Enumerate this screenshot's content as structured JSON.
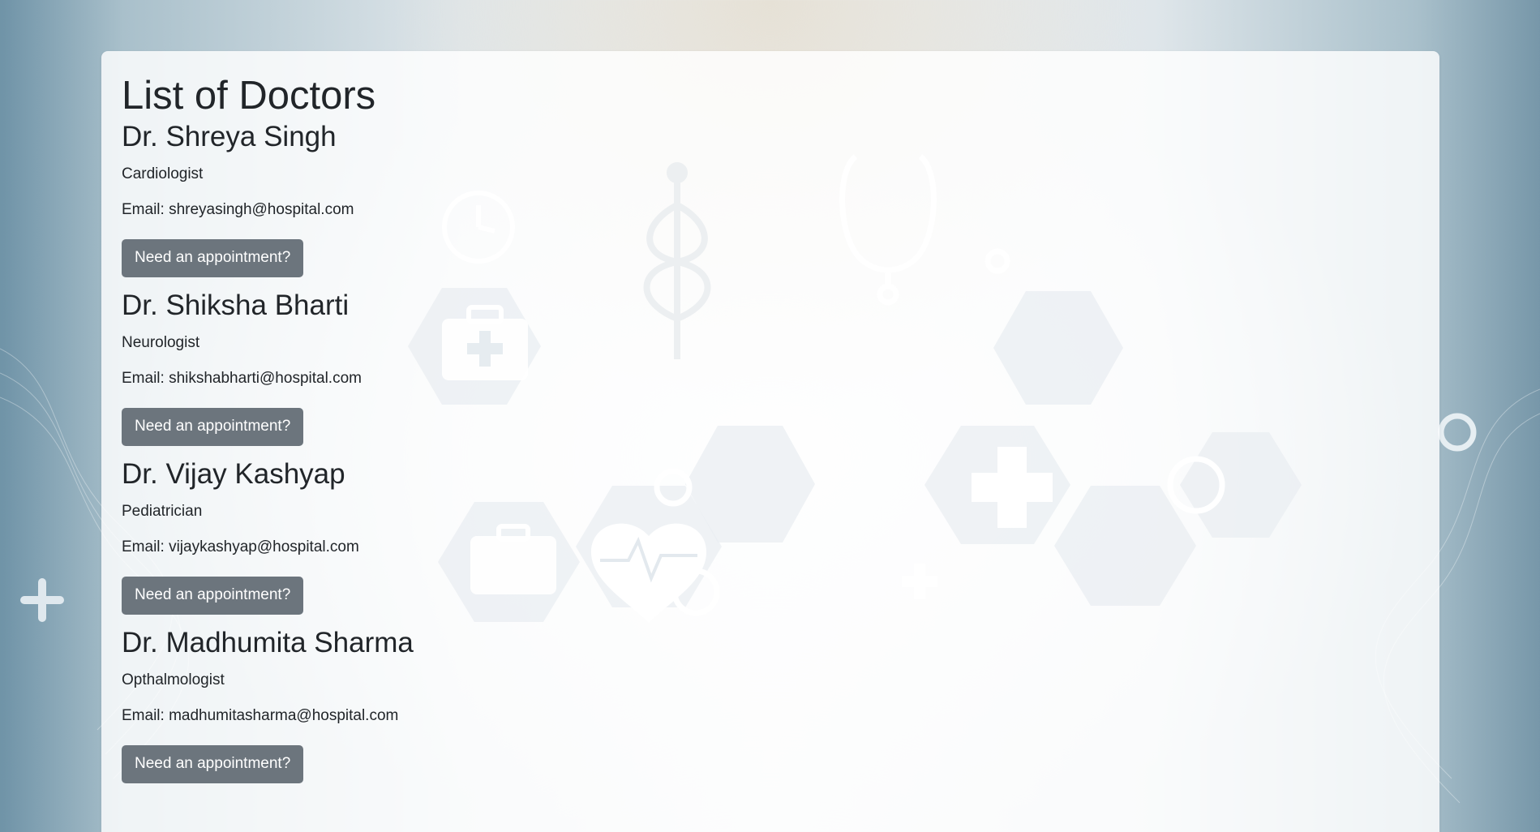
{
  "page": {
    "title": "List of Doctors"
  },
  "doctors": [
    {
      "name": "Dr. Shreya Singh",
      "specialty": "Cardiologist",
      "email": "Email: shreyasingh@hospital.com",
      "button_label": "Need an appointment?"
    },
    {
      "name": "Dr. Shiksha Bharti",
      "specialty": "Neurologist",
      "email": "Email: shikshabharti@hospital.com",
      "button_label": "Need an appointment?"
    },
    {
      "name": "Dr. Vijay Kashyap",
      "specialty": "Pediatrician",
      "email": "Email: vijaykashyap@hospital.com",
      "button_label": "Need an appointment?"
    },
    {
      "name": "Dr. Madhumita Sharma",
      "specialty": "Opthalmologist",
      "email": "Email: madhumitasharma@hospital.com",
      "button_label": "Need an appointment?"
    }
  ],
  "colors": {
    "button_bg": "#6c757d",
    "text": "#212529",
    "background_blue": "#6f93a7"
  },
  "background_icons": [
    "clock-icon",
    "caduceus-icon",
    "stethoscope-icon",
    "first-aid-kit-icon",
    "heart-pulse-icon",
    "medical-cross-icon",
    "briefcase-icon"
  ]
}
